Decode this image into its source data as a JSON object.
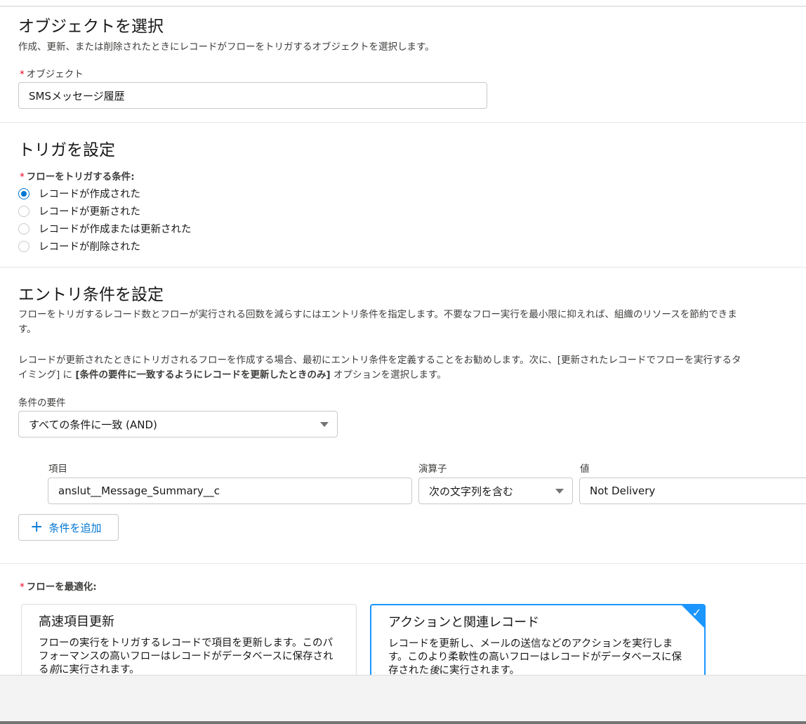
{
  "object_section": {
    "title": "オブジェクトを選択",
    "description": "作成、更新、または削除されたときにレコードがフローをトリガするオブジェクトを選択します。",
    "field_label": "オブジェクト",
    "field_value": "SMSメッセージ履歴"
  },
  "trigger_section": {
    "title": "トリガを設定",
    "label": "フローをトリガする条件:",
    "options": [
      {
        "label": "レコードが作成された",
        "selected": true
      },
      {
        "label": "レコードが更新された",
        "selected": false
      },
      {
        "label": "レコードが作成または更新された",
        "selected": false
      },
      {
        "label": "レコードが削除された",
        "selected": false
      }
    ]
  },
  "entry_section": {
    "title": "エントリ条件を設定",
    "description1": "フローをトリガするレコード数とフローが実行される回数を減らすにはエントリ条件を指定します。不要なフロー実行を最小限に抑えれば、組織のリソースを節約できます。",
    "description2_a": "レコードが更新されたときにトリガされるフローを作成する場合、最初にエントリ条件を定義することをお勧めします。次に、[更新されたレコードでフローを実行するタイミング] に ",
    "description2_bold": "[条件の要件に一致するようにレコードを更新したときのみ]",
    "description2_b": " オプションを選択します。",
    "requirement_label": "条件の要件",
    "requirement_value": "すべての条件に一致 (AND)",
    "condition": {
      "field_label": "項目",
      "field_value": "anslut__Message_Summary__c",
      "operator_label": "演算子",
      "operator_value": "次の文字列を含む",
      "value_label": "値",
      "value_value": "Not Delivery"
    },
    "add_button": "条件を追加"
  },
  "optimize_section": {
    "label": "フローを最適化:",
    "cards": [
      {
        "title": "高速項目更新",
        "desc_a": "フローの実行をトリガするレコードで項目を更新します。このパフォーマンスの高いフローはレコードがデータベースに保存される",
        "desc_em": "前",
        "desc_b": "に実行されます。",
        "selected": false
      },
      {
        "title": "アクションと関連レコード",
        "desc_a": "レコードを更新し、メールの送信などのアクションを実行します。このより柔軟性の高いフローはレコードがデータベースに保存された",
        "desc_em": "後",
        "desc_b": "に実行されます。",
        "selected": true
      }
    ]
  },
  "colors": {
    "accent": "#0176d3",
    "required": "#ea001e",
    "selected_border": "#1b96ff"
  }
}
